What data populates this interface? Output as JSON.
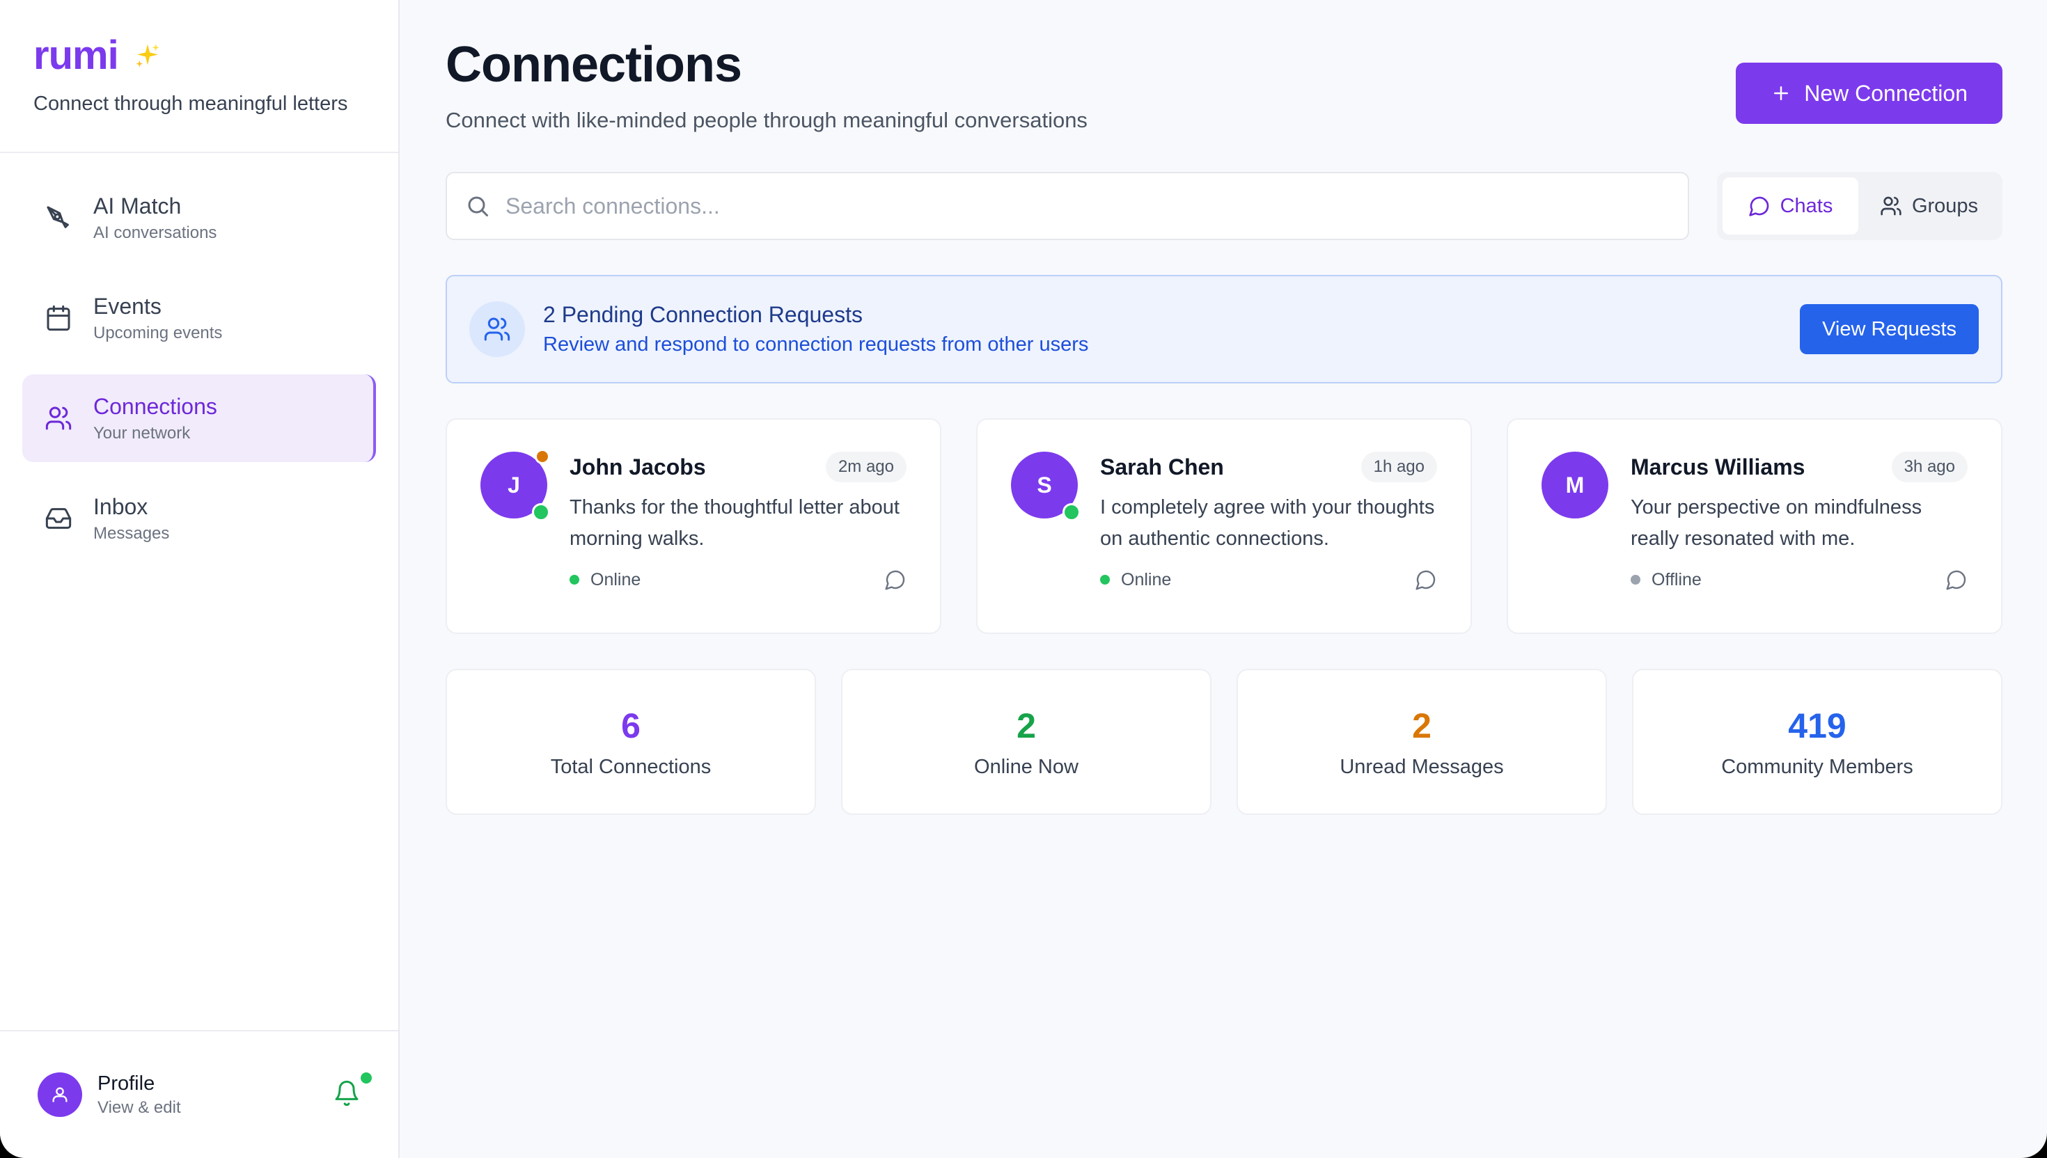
{
  "brand": {
    "name": "rumi",
    "tagline": "Connect through meaningful letters",
    "sparkle_icon": "sparkles-icon"
  },
  "sidebar": {
    "items": [
      {
        "title": "AI Match",
        "subtitle": "AI conversations",
        "icon": "pen-nib-icon",
        "active": false
      },
      {
        "title": "Events",
        "subtitle": "Upcoming events",
        "icon": "calendar-icon",
        "active": false
      },
      {
        "title": "Connections",
        "subtitle": "Your network",
        "icon": "users-icon",
        "active": true
      },
      {
        "title": "Inbox",
        "subtitle": "Messages",
        "icon": "inbox-icon",
        "active": false
      }
    ],
    "profile": {
      "name": "Profile",
      "subtitle": "View & edit"
    }
  },
  "header": {
    "title": "Connections",
    "subtitle": "Connect with like-minded people through meaningful conversations",
    "new_button": "New Connection"
  },
  "search": {
    "placeholder": "Search connections..."
  },
  "view_toggle": {
    "chats": "Chats",
    "groups": "Groups",
    "selected": "Chats"
  },
  "banner": {
    "title": "2 Pending Connection Requests",
    "subtitle": "Review and respond to connection requests from other users",
    "button": "View Requests"
  },
  "connections": [
    {
      "initial": "J",
      "name": "John Jacobs",
      "time": "2m ago",
      "message": "Thanks for the thoughtful letter about morning walks.",
      "status": "Online"
    },
    {
      "initial": "S",
      "name": "Sarah Chen",
      "time": "1h ago",
      "message": "I completely agree with your thoughts on authentic connections.",
      "status": "Online"
    },
    {
      "initial": "M",
      "name": "Marcus Williams",
      "time": "3h ago",
      "message": "Your perspective on mindfulness really resonated with me.",
      "status": "Offline"
    }
  ],
  "stats": [
    {
      "value": "6",
      "label": "Total Connections",
      "color": "#7c3aed"
    },
    {
      "value": "2",
      "label": "Online Now",
      "color": "#16a34a"
    },
    {
      "value": "2",
      "label": "Unread Messages",
      "color": "#d97706"
    },
    {
      "value": "419",
      "label": "Community Members",
      "color": "#2563eb"
    }
  ],
  "colors": {
    "accent": "#7c3aed",
    "online": "#22c55e",
    "offline": "#9ca3af",
    "info": "#2563eb"
  }
}
